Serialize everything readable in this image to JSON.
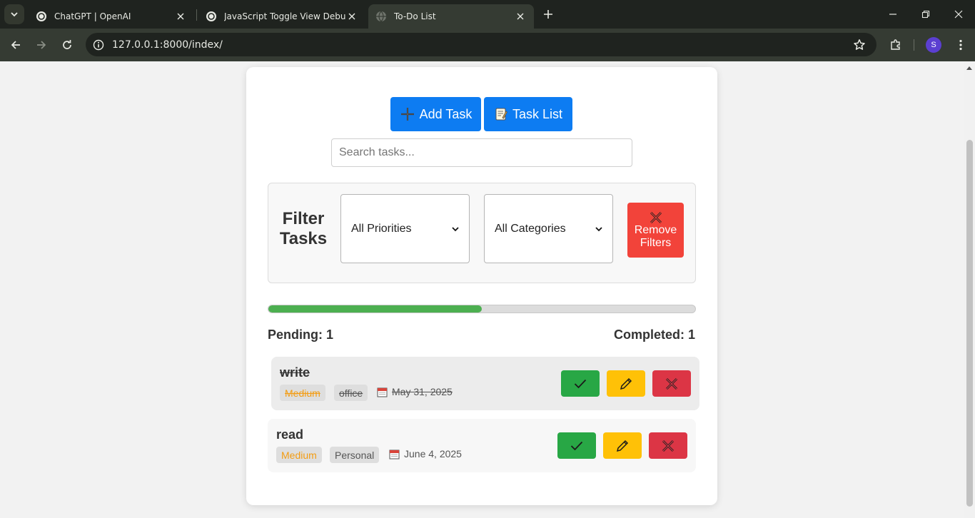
{
  "browser": {
    "tabs": [
      {
        "title": "ChatGPT | OpenAI",
        "active": false
      },
      {
        "title": "JavaScript Toggle View Debug",
        "active": false
      },
      {
        "title": "To-Do List",
        "active": true
      }
    ],
    "url": "127.0.0.1:8000/index/",
    "profile_initial": "S"
  },
  "header": {
    "add_task_label": "Add Task",
    "task_list_label": "Task List"
  },
  "search": {
    "placeholder": "Search tasks..."
  },
  "filters": {
    "title": "Filter Tasks",
    "priority_selected": "All Priorities",
    "category_selected": "All Categories",
    "remove_label": "Remove Filters"
  },
  "progress": {
    "completed_fraction": 0.5
  },
  "stats": {
    "pending_label": "Pending: 1",
    "completed_label": "Completed: 1"
  },
  "tasks": [
    {
      "name": "write",
      "priority": "Medium",
      "category": "office",
      "date": "May 31, 2025",
      "completed": true
    },
    {
      "name": "read",
      "priority": "Medium",
      "category": "Personal",
      "date": "June 4, 2025",
      "completed": false
    }
  ],
  "colors": {
    "primary": "#0d7cf2",
    "danger": "#f2433a",
    "success": "#28a745",
    "warning": "#ffc107",
    "progress": "#4caf50",
    "priority_medium": "#f39c12"
  }
}
